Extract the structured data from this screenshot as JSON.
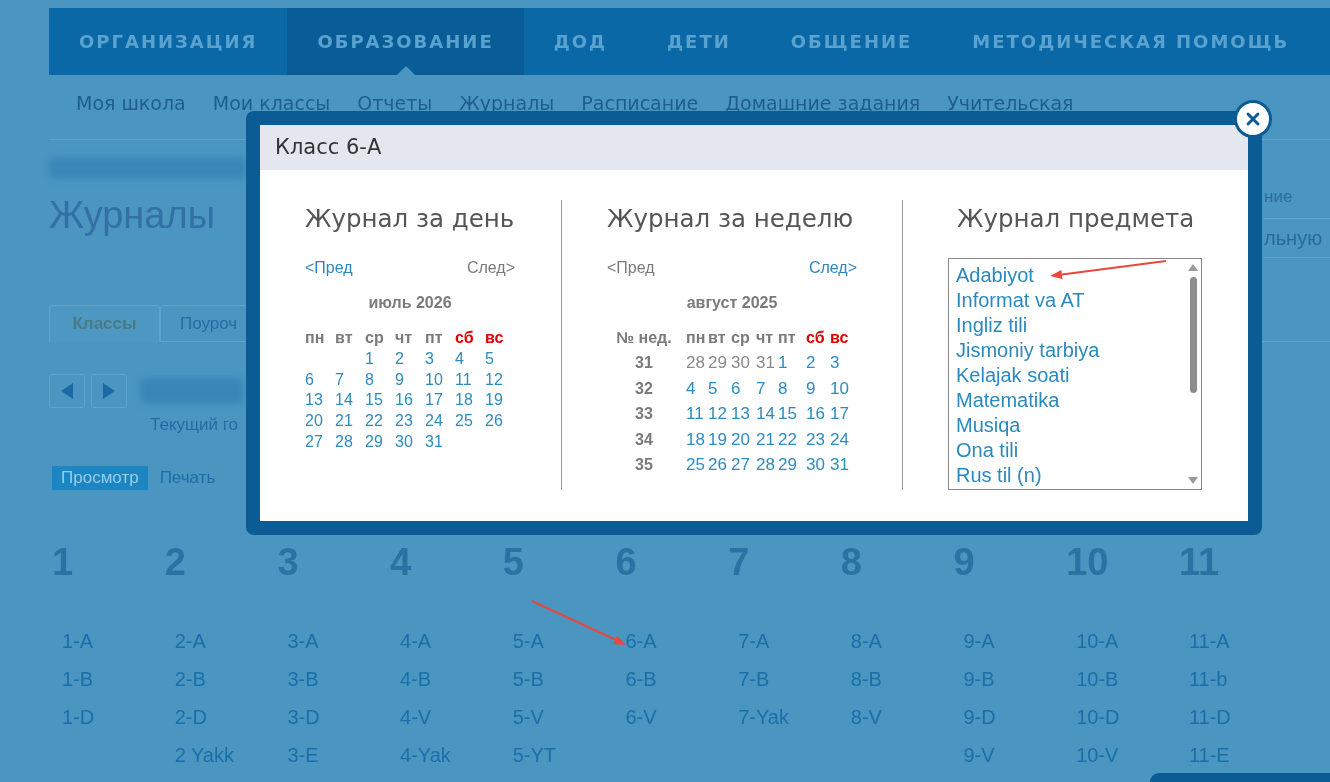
{
  "main_nav": [
    {
      "label": "ОРГАНИЗАЦИЯ",
      "selected": false
    },
    {
      "label": "ОБРАЗОВАНИЕ",
      "selected": true
    },
    {
      "label": "ДОД",
      "selected": false
    },
    {
      "label": "ДЕТИ",
      "selected": false
    },
    {
      "label": "ОБЩЕНИЕ",
      "selected": false
    },
    {
      "label": "МЕТОДИЧЕСКАЯ ПОМОЩЬ",
      "selected": false
    }
  ],
  "sub_nav": [
    "Моя школа",
    "Мои классы",
    "Отчеты",
    "Журналы",
    "Расписание",
    "Домашние задания",
    "Учительская"
  ],
  "page_title": "Журналы",
  "side_panel": {
    "label": "ние",
    "field_value": "льную"
  },
  "tabs": [
    {
      "label": "Классы",
      "selected": true
    },
    {
      "label": "Поуроч",
      "selected": false
    }
  ],
  "period_caption": "Текущий го",
  "view_modes": [
    {
      "label": "Просмотр",
      "selected": true
    },
    {
      "label": "Печать",
      "selected": false
    }
  ],
  "grades": [
    {
      "number": "1",
      "classes": [
        "1-A",
        "1-B",
        "1-D"
      ]
    },
    {
      "number": "2",
      "classes": [
        "2-A",
        "2-B",
        "2-D",
        "2 Yakk"
      ]
    },
    {
      "number": "3",
      "classes": [
        "3-A",
        "3-B",
        "3-D",
        "3-E"
      ]
    },
    {
      "number": "4",
      "classes": [
        "4-A",
        "4-B",
        "4-V",
        "4-Yak"
      ]
    },
    {
      "number": "5",
      "classes": [
        "5-A",
        "5-B",
        "5-V",
        "5-YT"
      ]
    },
    {
      "number": "6",
      "classes": [
        "6-A",
        "6-B",
        "6-V"
      ]
    },
    {
      "number": "7",
      "classes": [
        "7-A",
        "7-B",
        "7-Yak"
      ]
    },
    {
      "number": "8",
      "classes": [
        "8-A",
        "8-B",
        "8-V"
      ]
    },
    {
      "number": "9",
      "classes": [
        "9-A",
        "9-B",
        "9-D",
        "9-V"
      ]
    },
    {
      "number": "10",
      "classes": [
        "10-A",
        "10-B",
        "10-D",
        "10-V"
      ]
    },
    {
      "number": "11",
      "classes": [
        "11-A",
        "11-b",
        "11-D",
        "11-E"
      ]
    }
  ],
  "modal": {
    "title": "Класс 6-А",
    "day_journal": {
      "heading": "Журнал за день",
      "prev": {
        "label": "<Пред",
        "disabled": false
      },
      "next": {
        "label": "След>",
        "disabled": true
      },
      "month": "июль 2026",
      "weekdays": [
        {
          "label": "пн",
          "weekend": false
        },
        {
          "label": "вт",
          "weekend": false
        },
        {
          "label": "ср",
          "weekend": false
        },
        {
          "label": "чт",
          "weekend": false
        },
        {
          "label": "пт",
          "weekend": false
        },
        {
          "label": "сб",
          "weekend": true
        },
        {
          "label": "вс",
          "weekend": true
        }
      ],
      "weeks": [
        [
          "1",
          "2",
          "3",
          "4",
          "5"
        ],
        [
          "6",
          "7",
          "8",
          "9",
          "10",
          "11",
          "12"
        ],
        [
          "13",
          "14",
          "15",
          "16",
          "17",
          "18",
          "19"
        ],
        [
          "20",
          "21",
          "22",
          "23",
          "24",
          "25",
          "26"
        ],
        [
          "27",
          "28",
          "29",
          "30",
          "31"
        ]
      ]
    },
    "week_journal": {
      "heading": "Журнал за неделю",
      "prev": {
        "label": "<Пред",
        "disabled": true
      },
      "next": {
        "label": "След>",
        "disabled": false
      },
      "month": "август 2025",
      "week_header": "№ нед.",
      "weekdays": [
        {
          "label": "пн",
          "weekend": false
        },
        {
          "label": "вт",
          "weekend": false
        },
        {
          "label": "ср",
          "weekend": false
        },
        {
          "label": "чт",
          "weekend": false
        },
        {
          "label": "пт",
          "weekend": false
        },
        {
          "label": "сб",
          "weekend": true
        },
        {
          "label": "вс",
          "weekend": true
        }
      ],
      "weeks": [
        {
          "number": "31",
          "days": [
            {
              "day": "28",
              "outside": true
            },
            {
              "day": "29",
              "outside": true
            },
            {
              "day": "30",
              "outside": true
            },
            {
              "day": "31",
              "outside": true
            },
            {
              "day": "1",
              "outside": false
            },
            {
              "day": "2",
              "outside": false
            },
            {
              "day": "3",
              "outside": false
            }
          ]
        },
        {
          "number": "32",
          "days": [
            {
              "day": "4",
              "outside": false
            },
            {
              "day": "5",
              "outside": false
            },
            {
              "day": "6",
              "outside": false
            },
            {
              "day": "7",
              "outside": false
            },
            {
              "day": "8",
              "outside": false
            },
            {
              "day": "9",
              "outside": false
            },
            {
              "day": "10",
              "outside": false
            }
          ]
        },
        {
          "number": "33",
          "days": [
            {
              "day": "11",
              "outside": false
            },
            {
              "day": "12",
              "outside": false
            },
            {
              "day": "13",
              "outside": false
            },
            {
              "day": "14",
              "outside": false
            },
            {
              "day": "15",
              "outside": false
            },
            {
              "day": "16",
              "outside": false
            },
            {
              "day": "17",
              "outside": false
            }
          ]
        },
        {
          "number": "34",
          "days": [
            {
              "day": "18",
              "outside": false
            },
            {
              "day": "19",
              "outside": false
            },
            {
              "day": "20",
              "outside": false
            },
            {
              "day": "21",
              "outside": false
            },
            {
              "day": "22",
              "outside": false
            },
            {
              "day": "23",
              "outside": false
            },
            {
              "day": "24",
              "outside": false
            }
          ]
        },
        {
          "number": "35",
          "days": [
            {
              "day": "25",
              "outside": false
            },
            {
              "day": "26",
              "outside": false
            },
            {
              "day": "27",
              "outside": false
            },
            {
              "day": "28",
              "outside": false
            },
            {
              "day": "29",
              "outside": false
            },
            {
              "day": "30",
              "outside": false
            },
            {
              "day": "31",
              "outside": false
            }
          ]
        }
      ]
    },
    "subject_journal": {
      "heading": "Журнал предмета",
      "subjects": [
        "Adabiyot",
        "Informat va AT",
        "Ingliz tili",
        "Jismoniy tarbiya",
        "Kelajak soati",
        "Matematika",
        "Musiqa",
        "Ona tili",
        "Rus til (n)"
      ]
    }
  }
}
